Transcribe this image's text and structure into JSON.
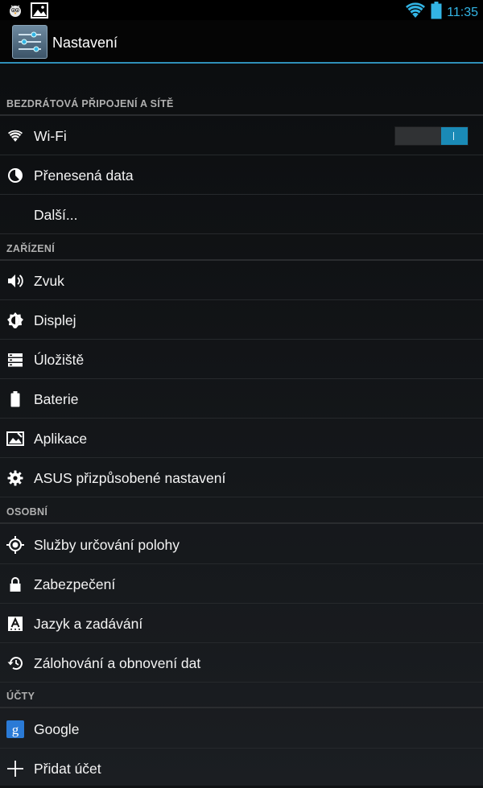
{
  "status_bar": {
    "time": "11:35",
    "icons": [
      "bird-notification-icon",
      "image-notification-icon",
      "wifi-signal-icon",
      "battery-icon"
    ]
  },
  "action_bar": {
    "title": "Nastavení",
    "icon": "settings-sliders-icon"
  },
  "sections": [
    {
      "header": "BEZDRÁTOVÁ PŘIPOJENÍ A SÍTĚ",
      "items": [
        {
          "label": "Wi-Fi",
          "icon": "wifi-icon",
          "toggle": "on"
        },
        {
          "label": "Přenesená data",
          "icon": "data-usage-icon"
        },
        {
          "label": "Další...",
          "icon": ""
        }
      ]
    },
    {
      "header": "ZAŘÍZENÍ",
      "items": [
        {
          "label": "Zvuk",
          "icon": "speaker-icon"
        },
        {
          "label": "Displej",
          "icon": "brightness-icon"
        },
        {
          "label": "Úložiště",
          "icon": "storage-icon"
        },
        {
          "label": "Baterie",
          "icon": "battery-icon"
        },
        {
          "label": "Aplikace",
          "icon": "apps-icon"
        },
        {
          "label": "ASUS přizpůsobené nastavení",
          "icon": "gear-icon"
        }
      ]
    },
    {
      "header": "OSOBNÍ",
      "items": [
        {
          "label": "Služby určování polohy",
          "icon": "location-icon"
        },
        {
          "label": "Zabezpečení",
          "icon": "lock-icon"
        },
        {
          "label": "Jazyk a zadávání",
          "icon": "keyboard-language-icon"
        },
        {
          "label": "Zálohování a obnovení dat",
          "icon": "backup-restore-icon"
        }
      ]
    },
    {
      "header": "ÚČTY",
      "items": [
        {
          "label": "Google",
          "icon": "google-icon"
        },
        {
          "label": "Přidat účet",
          "icon": "plus-icon"
        }
      ]
    }
  ],
  "colors": {
    "accent": "#33b5e5",
    "toggle_on": "#1a8ab6",
    "background": "#101214"
  }
}
